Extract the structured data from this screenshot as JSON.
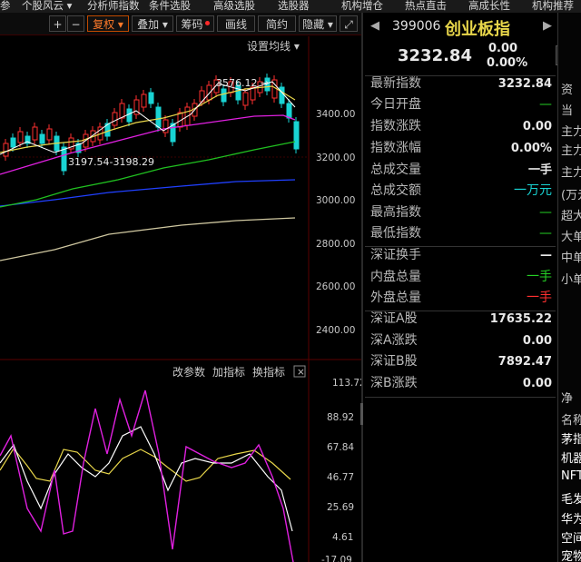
{
  "menubar": {
    "items": [
      "参",
      "个股风云 ▾",
      "分析师指数",
      "条件选股",
      "高级选股",
      "选股器",
      "机构增仓",
      "热点直击",
      "高成长性",
      "机构推荐"
    ]
  },
  "toolbar": {
    "plus": "+",
    "minus": "−",
    "buttons": [
      "复权 ▾",
      "叠加 ▾",
      "筹码",
      "画线",
      "简约",
      "隐藏 ▾"
    ],
    "active": "复权 ▾",
    "expand_icon": "⤢"
  },
  "main_chart": {
    "set_ma_label": "设置均线 ▾",
    "high_note": "3576.12 →",
    "low_note": "3197.54-3198.29",
    "price_axis": [
      "3400.00",
      "3200.00",
      "3000.00",
      "2800.00",
      "2600.00",
      "2400.00"
    ]
  },
  "indicator_panel": {
    "links": [
      "改参数",
      "加指标",
      "换指标"
    ],
    "close_icon": "×",
    "axis": [
      "113.72",
      "88.92",
      "67.84",
      "46.77",
      "25.69",
      "4.61",
      "-17.09"
    ]
  },
  "quote_header": {
    "code": "399006",
    "name": "创业板指",
    "price": "3232.84",
    "change": "0.00",
    "change_pct": "0.00%",
    "prev_arrow": "◀",
    "next_arrow": "▶",
    "side_button": "自"
  },
  "quote_rows": [
    {
      "k": "最新指数",
      "v": "3232.84",
      "c": "white"
    },
    {
      "k": "今日开盘",
      "v": "—",
      "c": "green"
    },
    {
      "k": "指数涨跌",
      "v": "0.00",
      "c": "white"
    },
    {
      "k": "指数涨幅",
      "v": "0.00%",
      "c": "white"
    },
    {
      "k": "总成交量",
      "v": "一手",
      "c": "white"
    },
    {
      "k": "总成交额",
      "v": "一万元",
      "c": "cyan"
    },
    {
      "k": "最高指数",
      "v": "—",
      "c": "green"
    },
    {
      "k": "最低指数",
      "v": "—",
      "c": "green"
    },
    {
      "k": "深证换手",
      "v": "—",
      "c": "white"
    },
    {
      "k": "内盘总量",
      "v": "一手",
      "c": "green"
    },
    {
      "k": "外盘总量",
      "v": "一手",
      "c": "red"
    },
    {
      "k": "深证A股",
      "v": "17635.22",
      "c": "white"
    },
    {
      "k": "深A涨跌",
      "v": "0.00",
      "c": "white"
    },
    {
      "k": "深证B股",
      "v": "7892.47",
      "c": "white"
    },
    {
      "k": "深B涨跌",
      "v": "0.00",
      "c": "white"
    }
  ],
  "far_right": [
    "资",
    "当",
    "主力",
    "主力",
    "主力",
    "(万元",
    "超大",
    "大单",
    "中单",
    "小单",
    "净",
    "名称",
    "茅指",
    "机器",
    "NFT",
    "毛发",
    "华为",
    "空间",
    "宠物"
  ],
  "colors": {
    "up": "#ff3030",
    "down": "#19d3d3",
    "ma5": "#ffffff",
    "ma10": "#e8d64a",
    "ma20": "#e020e0",
    "ma60": "#20c020",
    "ma120": "#2040ff",
    "ma250": "#cfc7a0"
  }
}
